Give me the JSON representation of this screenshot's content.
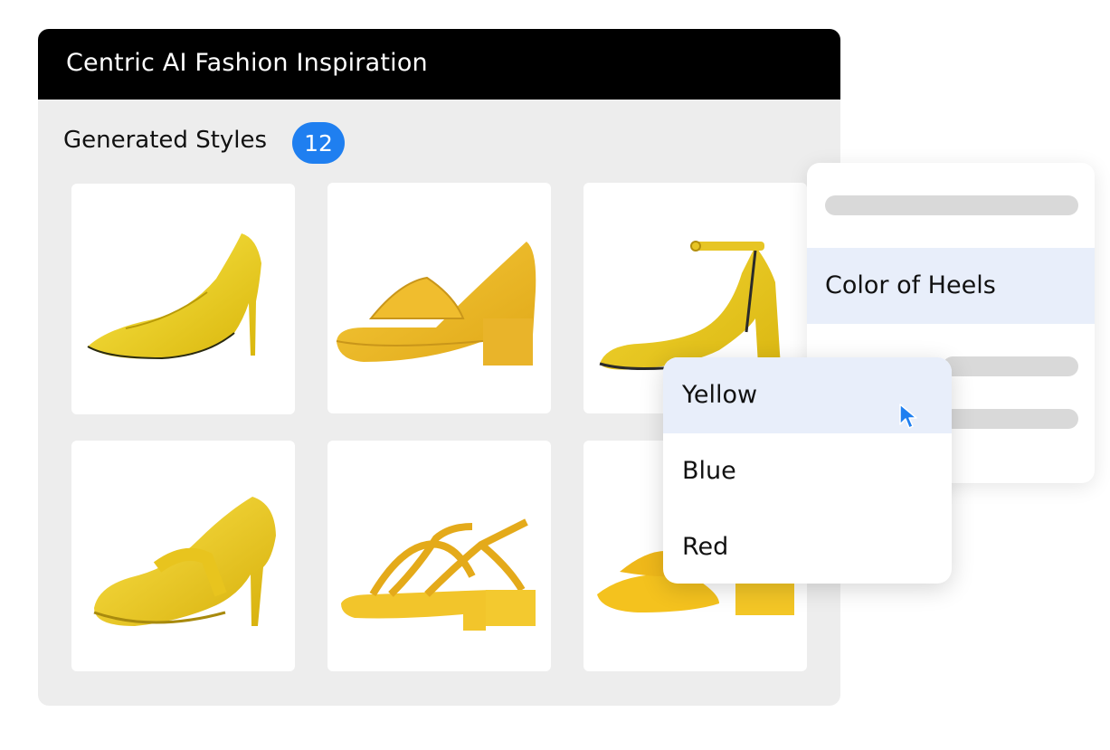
{
  "window": {
    "title": "Centric AI Fashion Inspiration"
  },
  "gallery": {
    "section_title": "Generated Styles",
    "count": "12",
    "items": [
      {
        "name": "yellow-pointed-stiletto-pump"
      },
      {
        "name": "yellow-peep-toe-block-heel"
      },
      {
        "name": "yellow-suede-ankle-strap-heel"
      },
      {
        "name": "yellow-mary-jane-stiletto"
      },
      {
        "name": "yellow-strappy-block-sandal"
      },
      {
        "name": "yellow-platform-slide-sandal"
      }
    ]
  },
  "filter_panel": {
    "selected_item": "Color of Heels"
  },
  "dropdown": {
    "options": [
      "Yellow",
      "Blue",
      "Red"
    ],
    "hovered_option": "Yellow"
  },
  "colors": {
    "title_bar": "#000000",
    "window_background": "#ededed",
    "badge": "#1f7ff0",
    "highlight": "#e8eefa",
    "cursor": "#1f7ff0",
    "shoe_yellow": "#f2d21b"
  }
}
